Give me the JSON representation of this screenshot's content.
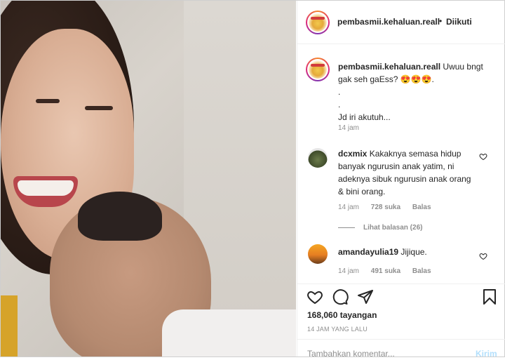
{
  "header": {
    "username": "pembasmii.kehaluan.reall",
    "separator": "•",
    "follow_status": "Diikuti"
  },
  "caption": {
    "username": "pembasmii.kehaluan.reall",
    "line1": "Uwuu bngt gak seh gaEss? 😍😍😍.",
    "line2": ".",
    "line3": ".",
    "line4": "Jd iri akutuh...",
    "time": "14 jam"
  },
  "comments": [
    {
      "username": "dcxmix",
      "text": "Kakaknya semasa hidup banyak ngurusin anak yatim, ni adeknya sibuk ngurusin anak orang & bini orang.",
      "time": "14 jam",
      "likes": "728 suka",
      "reply": "Balas",
      "view_replies": "Lihat balasan (26)"
    },
    {
      "username": "amandayulia19",
      "text": "Jijique.",
      "time": "14 jam",
      "likes": "491 suka",
      "reply": "Balas"
    }
  ],
  "actions": {
    "views": "168,060 tayangan",
    "time_ago": "14 JAM YANG LALU",
    "add_comment_placeholder": "Tambahkan komentar...",
    "post_label": "Kirim"
  },
  "icons": {
    "like": "heart-icon",
    "comment": "comment-icon",
    "share": "share-icon",
    "save": "bookmark-icon"
  }
}
